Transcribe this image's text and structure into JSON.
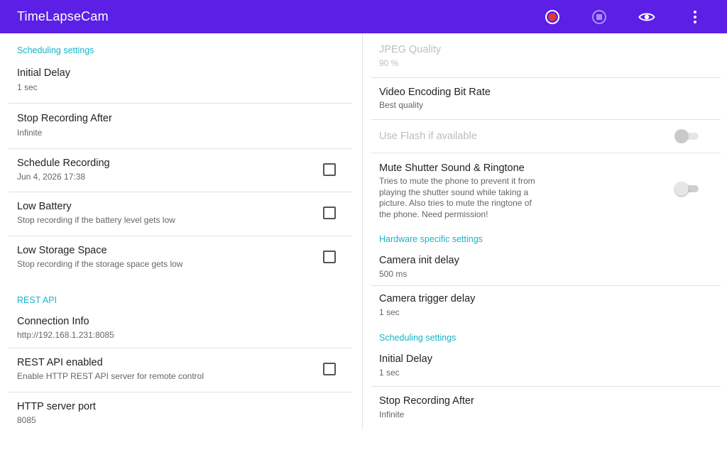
{
  "appbar": {
    "title": "TimeLapseCam",
    "actions": [
      {
        "icon": "record-icon",
        "color": "#e53935"
      },
      {
        "icon": "stop-icon"
      },
      {
        "icon": "eye-icon"
      },
      {
        "icon": "more-vert-icon"
      }
    ],
    "color": "#5b1fe6"
  },
  "left": {
    "section_scheduling": "Scheduling settings",
    "initial_delay": {
      "title": "Initial Delay",
      "summary": "1 sec"
    },
    "stop_recording": {
      "title": "Stop Recording After",
      "summary": "Infinite"
    },
    "schedule_recording": {
      "title": "Schedule Recording",
      "summary": "Jun 4, 2026 17:38",
      "checked": false
    },
    "low_battery": {
      "title": "Low Battery",
      "summary": "Stop recording if the battery level gets low",
      "checked": false
    },
    "low_storage": {
      "title": "Low Storage Space",
      "summary": "Stop recording if the storage space gets low",
      "checked": false
    },
    "section_rest": "REST API",
    "connection_info": {
      "title": "Connection Info",
      "summary": "http://192.168.1.231:8085"
    },
    "rest_enabled": {
      "title": "REST API enabled",
      "summary": "Enable HTTP REST API server for remote control",
      "checked": false
    },
    "http_port": {
      "title": "HTTP server port",
      "summary": "8085"
    }
  },
  "right": {
    "jpeg_quality": {
      "title": "JPEG Quality",
      "summary": "90 %",
      "enabled": false
    },
    "video_bitrate": {
      "title": "Video Encoding Bit Rate",
      "summary": "Best quality"
    },
    "use_flash": {
      "title": "Use Flash if available",
      "enabled": false,
      "on": false
    },
    "mute_shutter": {
      "title": "Mute Shutter Sound & Ringtone",
      "summary_lines": [
        "Tries to mute the phone to prevent it from",
        "playing the shutter sound while taking a",
        "picture. Also tries to mute the ringtone of",
        "the phone. Need permission!"
      ],
      "on": false
    },
    "section_hardware": "Hardware specific settings",
    "camera_init_delay": {
      "title": "Camera init delay",
      "summary": "500 ms"
    },
    "camera_trigger_delay": {
      "title": "Camera trigger delay",
      "summary": "1 sec"
    },
    "section_scheduling": "Scheduling settings",
    "initial_delay": {
      "title": "Initial Delay",
      "summary": "1 sec"
    },
    "stop_recording": {
      "title": "Stop Recording After",
      "summary": "Infinite"
    }
  },
  "colors": {
    "accent": "#1ab3c9",
    "appbar": "#5b1fe6"
  }
}
